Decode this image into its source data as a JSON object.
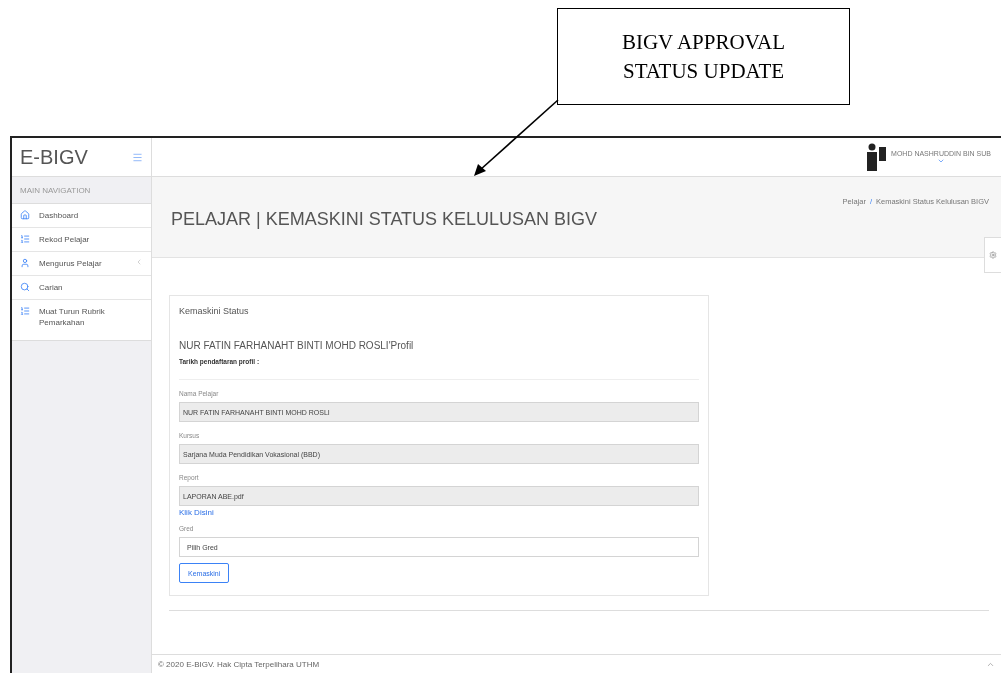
{
  "callout": {
    "lines": [
      "BIGV APPROVAL",
      "STATUS UPDATE"
    ]
  },
  "sidebar": {
    "logo": "E-BIGV",
    "section": "MAIN NAVIGATION",
    "items": [
      {
        "label": "Dashboard",
        "kind": "home",
        "expandable": false
      },
      {
        "label": "Rekod Pelajar",
        "kind": "list",
        "expandable": false
      },
      {
        "label": "Mengurus Pelajar",
        "kind": "user",
        "expandable": true
      },
      {
        "label": "Carian",
        "kind": "search",
        "expandable": false
      },
      {
        "label": "Muat Turun Rubrik Pemarkahan",
        "kind": "list",
        "expandable": false
      }
    ]
  },
  "topbar": {
    "user": "MOHD NASHRUDDIN BIN SUB"
  },
  "header": {
    "title": "PELAJAR | KEMASKINI STATUS KELULUSAN BIGV",
    "breadcrumb": [
      "Pelajar",
      "Kemaskini Status Kelulusan BIGV"
    ],
    "breadcrumb_separator": "/"
  },
  "card": {
    "title": "Kemaskini Status",
    "name": "NUR FATIN FARHANAHT BINTI MOHD ROSLI'Profil",
    "date_label": "Tarikh pendaftaran profil :",
    "fields": [
      {
        "label": "Nama Pelajar",
        "value": "NUR FATIN FARHANAHT BINTI MOHD ROSLI",
        "kind": "readonly"
      },
      {
        "label": "Kursus",
        "value": "Sarjana Muda Pendidikan Vokasional (BBD)",
        "kind": "readonly"
      },
      {
        "label": "Report",
        "value": "LAPORAN ABE.pdf",
        "kind": "readonly",
        "link": "Klik Disini"
      },
      {
        "label": "Gred",
        "value": "Pilih Gred",
        "kind": "select"
      }
    ],
    "button": "Kemaskini"
  },
  "footer": {
    "text": "© 2020 E-BIGV. Hak Cipta Terpelihara UTHM"
  }
}
